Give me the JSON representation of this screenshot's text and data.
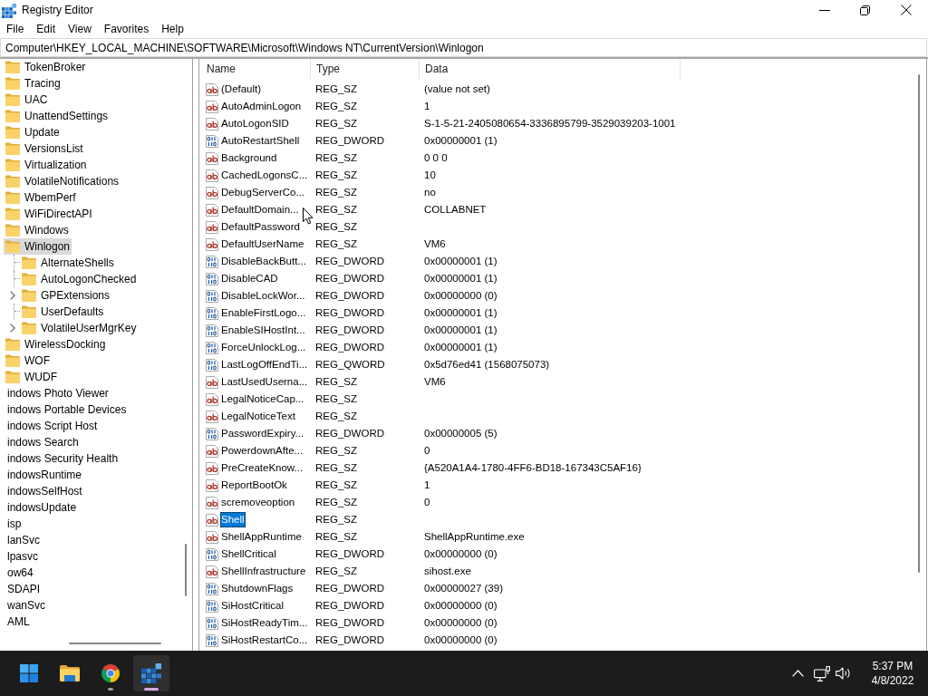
{
  "window": {
    "title": "Registry Editor"
  },
  "menu": [
    "File",
    "Edit",
    "View",
    "Favorites",
    "Help"
  ],
  "address": "Computer\\HKEY_LOCAL_MACHINE\\SOFTWARE\\Microsoft\\Windows NT\\CurrentVersion\\Winlogon",
  "tree": [
    {
      "children": [
        {
          "children": [
            {
              "label": "TokenBroker",
              "selected": false
            },
            {
              "label": "Tracing",
              "selected": false
            },
            {
              "label": "UAC",
              "selected": false
            },
            {
              "label": "UnattendSettings",
              "selected": false
            },
            {
              "label": "Update",
              "selected": false
            },
            {
              "label": "VersionsList",
              "selected": false
            },
            {
              "label": "Virtualization",
              "selected": false
            },
            {
              "label": "VolatileNotifications",
              "selected": false
            },
            {
              "label": "WbemPerf",
              "selected": false
            },
            {
              "label": "WiFiDirectAPI",
              "selected": false
            },
            {
              "label": "Windows",
              "selected": false
            },
            {
              "label": "Winlogon",
              "selected": true,
              "children": [
                {
                  "label": "AlternateShells",
                  "selected": false
                },
                {
                  "label": "AutoLogonChecked",
                  "selected": false
                },
                {
                  "label": "GPExtensions",
                  "selected": false,
                  "expanded": false
                },
                {
                  "label": "UserDefaults",
                  "selected": false
                },
                {
                  "label": "VolatileUserMgrKey",
                  "selected": false,
                  "expanded": false
                }
              ]
            },
            {
              "label": "WirelessDocking",
              "selected": false
            },
            {
              "label": "WOF",
              "selected": false
            },
            {
              "label": "WUDF",
              "selected": false
            }
          ]
        }
      ]
    },
    {
      "label": "indows Photo Viewer",
      "selected": false
    },
    {
      "label": "indows Portable Devices",
      "selected": false
    },
    {
      "label": "indows Script Host",
      "selected": false
    },
    {
      "label": "indows Search",
      "selected": false
    },
    {
      "label": "indows Security Health",
      "selected": false
    },
    {
      "label": "indowsRuntime",
      "selected": false
    },
    {
      "label": "indowsSelfHost",
      "selected": false
    },
    {
      "label": "indowsUpdate",
      "selected": false
    },
    {
      "label": "isp",
      "selected": false
    },
    {
      "label": "lanSvc",
      "selected": false
    },
    {
      "label": "lpasvc",
      "selected": false
    },
    {
      "label": "ow64",
      "selected": false
    },
    {
      "label": "SDAPI",
      "selected": false
    },
    {
      "label": "wanSvc",
      "selected": false
    },
    {
      "label": "AML",
      "selected": false
    }
  ],
  "values": {
    "columns": [
      "Name",
      "Type",
      "Data"
    ],
    "rows": [
      {
        "name": "(Default)",
        "type": "REG_SZ",
        "data": "(value not set)",
        "kind": "string",
        "selected": false
      },
      {
        "name": "AutoAdminLogon",
        "type": "REG_SZ",
        "data": "1",
        "kind": "string",
        "selected": false
      },
      {
        "name": "AutoLogonSID",
        "type": "REG_SZ",
        "data": "S-1-5-21-2405080654-3336895799-3529039203-1001",
        "kind": "string",
        "selected": false
      },
      {
        "name": "AutoRestartShell",
        "type": "REG_DWORD",
        "data": "0x00000001 (1)",
        "kind": "binary",
        "selected": false
      },
      {
        "name": "Background",
        "type": "REG_SZ",
        "data": "0 0 0",
        "kind": "string",
        "selected": false
      },
      {
        "name": "CachedLogonsC...",
        "type": "REG_SZ",
        "data": "10",
        "kind": "string",
        "selected": false
      },
      {
        "name": "DebugServerCo...",
        "type": "REG_SZ",
        "data": "no",
        "kind": "string",
        "selected": false
      },
      {
        "name": "DefaultDomain...",
        "type": "REG_SZ",
        "data": "COLLABNET",
        "kind": "string",
        "selected": false
      },
      {
        "name": "DefaultPassword",
        "type": "REG_SZ",
        "kind": "string",
        "selected": false
      },
      {
        "name": "DefaultUserName",
        "type": "REG_SZ",
        "data": "VM6",
        "kind": "string",
        "selected": false
      },
      {
        "name": "DisableBackButt...",
        "type": "REG_DWORD",
        "data": "0x00000001 (1)",
        "kind": "binary",
        "selected": false
      },
      {
        "name": "DisableCAD",
        "type": "REG_DWORD",
        "data": "0x00000001 (1)",
        "kind": "binary",
        "selected": false
      },
      {
        "name": "DisableLockWor...",
        "type": "REG_DWORD",
        "data": "0x00000000 (0)",
        "kind": "binary",
        "selected": false
      },
      {
        "name": "EnableFirstLogo...",
        "type": "REG_DWORD",
        "data": "0x00000001 (1)",
        "kind": "binary",
        "selected": false
      },
      {
        "name": "EnableSIHostInt...",
        "type": "REG_DWORD",
        "data": "0x00000001 (1)",
        "kind": "binary",
        "selected": false
      },
      {
        "name": "ForceUnlockLog...",
        "type": "REG_DWORD",
        "data": "0x00000001 (1)",
        "kind": "binary",
        "selected": false
      },
      {
        "name": "LastLogOffEndTi...",
        "type": "REG_QWORD",
        "data": "0x5d76ed41 (1568075073)",
        "kind": "binary",
        "selected": false
      },
      {
        "name": "LastUsedUserna...",
        "type": "REG_SZ",
        "data": "VM6",
        "kind": "string",
        "selected": false
      },
      {
        "name": "LegalNoticeCap...",
        "type": "REG_SZ",
        "kind": "string",
        "selected": false
      },
      {
        "name": "LegalNoticeText",
        "type": "REG_SZ",
        "kind": "string",
        "selected": false
      },
      {
        "name": "PasswordExpiry...",
        "type": "REG_DWORD",
        "data": "0x00000005 (5)",
        "kind": "binary",
        "selected": false
      },
      {
        "name": "PowerdownAfte...",
        "type": "REG_SZ",
        "data": "0",
        "kind": "string",
        "selected": false
      },
      {
        "name": "PreCreateKnow...",
        "type": "REG_SZ",
        "data": "{A520A1A4-1780-4FF6-BD18-167343C5AF16}",
        "kind": "string",
        "selected": false
      },
      {
        "name": "ReportBootOk",
        "type": "REG_SZ",
        "data": "1",
        "kind": "string",
        "selected": false
      },
      {
        "name": "scremoveoption",
        "type": "REG_SZ",
        "data": "0",
        "kind": "string",
        "selected": false
      },
      {
        "name": "Shell",
        "type": "REG_SZ",
        "kind": "string",
        "selected": true
      },
      {
        "name": "ShellAppRuntime",
        "type": "REG_SZ",
        "data": "ShellAppRuntime.exe",
        "kind": "string",
        "selected": false
      },
      {
        "name": "ShellCritical",
        "type": "REG_DWORD",
        "data": "0x00000000 (0)",
        "kind": "binary",
        "selected": false
      },
      {
        "name": "ShellInfrastructure",
        "type": "REG_SZ",
        "data": "sihost.exe",
        "kind": "string",
        "selected": false
      },
      {
        "name": "ShutdownFlags",
        "type": "REG_DWORD",
        "data": "0x00000027 (39)",
        "kind": "binary",
        "selected": false
      },
      {
        "name": "SiHostCritical",
        "type": "REG_DWORD",
        "data": "0x00000000 (0)",
        "kind": "binary",
        "selected": false
      },
      {
        "name": "SiHostReadyTim...",
        "type": "REG_DWORD",
        "data": "0x00000000 (0)",
        "kind": "binary",
        "selected": false
      },
      {
        "name": "SiHostRestartCo...",
        "type": "REG_DWORD",
        "data": "0x00000000 (0)",
        "kind": "binary",
        "selected": false
      }
    ]
  },
  "taskbar": {
    "apps": [
      {
        "kind": "start",
        "running": false,
        "selected": false
      },
      {
        "kind": "folder",
        "running": false,
        "selected": false
      },
      {
        "kind": "browser",
        "running": true,
        "selected": false
      },
      {
        "kind": "registry",
        "running": true,
        "selected": true
      }
    ],
    "clock": {
      "time": "5:37 PM",
      "date": "4/8/2022"
    }
  }
}
